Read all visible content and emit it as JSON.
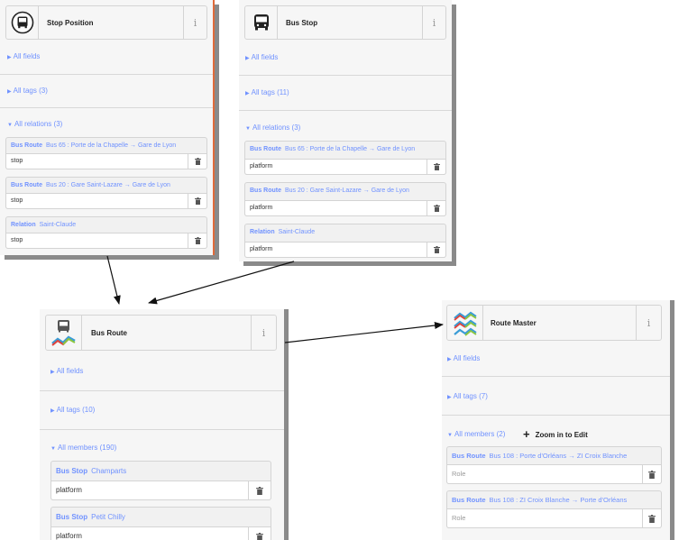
{
  "panels": {
    "stop_position": {
      "title": "Stop Position",
      "icon": "bus-stop-position-icon",
      "info": "i",
      "all_fields": "All fields",
      "all_tags": "All tags (3)",
      "all_relations": "All relations (3)",
      "relations": [
        {
          "type": "Bus Route",
          "name": "Bus 65 : Porte de la Chapelle → Gare de Lyon",
          "role": "stop"
        },
        {
          "type": "Bus Route",
          "name": "Bus 20 : Gare Saint-Lazare → Gare de Lyon",
          "role": "stop"
        },
        {
          "type": "Relation",
          "name": "Saint-Claude",
          "role": "stop"
        }
      ]
    },
    "bus_stop": {
      "title": "Bus Stop",
      "icon": "bus-icon",
      "info": "i",
      "all_fields": "All fields",
      "all_tags": "All tags (11)",
      "all_relations": "All relations (3)",
      "relations": [
        {
          "type": "Bus Route",
          "name": "Bus 65 : Porte de la Chapelle → Gare de Lyon",
          "role": "platform"
        },
        {
          "type": "Bus Route",
          "name": "Bus 20 : Gare Saint-Lazare → Gare de Lyon",
          "role": "platform"
        },
        {
          "type": "Relation",
          "name": "Saint-Claude",
          "role": "platform"
        }
      ]
    },
    "bus_route": {
      "title": "Bus Route",
      "icon": "bus-route-icon",
      "info": "i",
      "all_fields": "All fields",
      "all_tags": "All tags (10)",
      "all_members": "All members (190)",
      "members": [
        {
          "type": "Bus Stop",
          "name": "Champarts",
          "role": "platform"
        },
        {
          "type": "Bus Stop",
          "name": "Petit Chilly",
          "role": "platform"
        }
      ]
    },
    "route_master": {
      "title": "Route Master",
      "icon": "route-master-icon",
      "info": "i",
      "all_fields": "All fields",
      "all_tags": "All tags (7)",
      "all_members": "All members (2)",
      "zoom_in": "Zoom in to Edit",
      "members": [
        {
          "type": "Bus Route",
          "name": "Bus 108 : Porte d'Orléans → ZI Croix Blanche",
          "role_placeholder": "Role"
        },
        {
          "type": "Bus Route",
          "name": "Bus 108 : ZI Croix Blanche → Porte d'Orléans",
          "role_placeholder": "Role"
        }
      ]
    }
  },
  "colors": {
    "link": "#7092ff",
    "panel_bg": "#f6f6f6",
    "shadow": "#8a8a8a",
    "accent_border": "#e06a3a"
  }
}
